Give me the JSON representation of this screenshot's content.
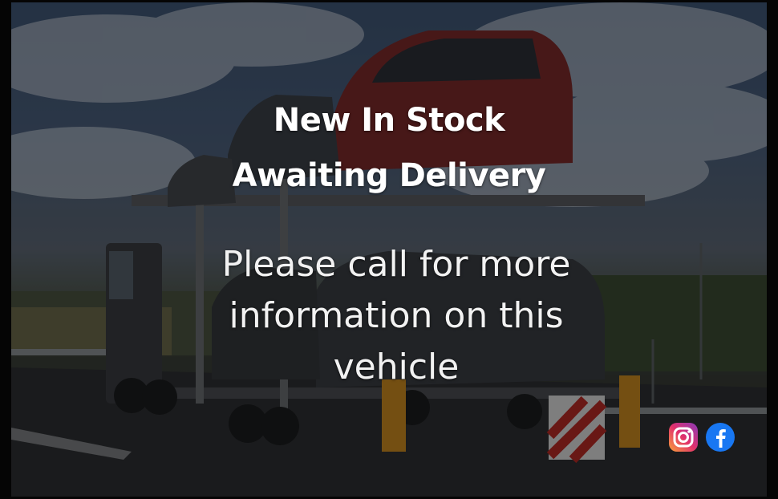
{
  "banner": {
    "headline_line1": "New In Stock",
    "headline_line2": "Awaiting Delivery",
    "info_text": "Please call for more information on this vehicle"
  },
  "social": {
    "icons": [
      "instagram-icon",
      "facebook-icon"
    ],
    "instagram_colors": [
      "#f9a13b",
      "#e1306c",
      "#8a3ab9"
    ],
    "facebook_color": "#1877f2"
  },
  "background": {
    "subject": "car transporter truck on highway",
    "overlay_color": "#000000"
  }
}
